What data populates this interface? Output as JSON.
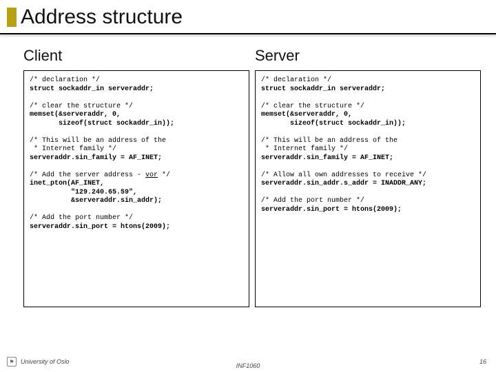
{
  "header": {
    "title": "Address structure"
  },
  "columns": {
    "client": {
      "heading": "Client",
      "code": "/* declaration */\n<b>struct sockaddr_in serveraddr;</b>\n\n/* clear the structure */\n<b>memset(&serveraddr, 0,</b>\n<b>       sizeof(struct sockaddr_in));</b>\n\n/* This will be an address of the\n * Internet family */\n<b>serveraddr.sin_family = AF_INET;</b>\n\n/* Add the server address - <span class=\"ul\">vor</span> */\n<b>inet_pton(AF_INET,</b>\n<b>          \"129.240.65.59\",</b>\n<b>          &serveraddr.sin_addr);</b>\n\n/* Add the port number */\n<b>serveraddr.sin_port = htons(2009);</b>"
    },
    "server": {
      "heading": "Server",
      "code": "/* declaration */\n<b>struct sockaddr_in serveraddr;</b>\n\n/* clear the structure */\n<b>memset(&serveraddr, 0,</b>\n<b>       sizeof(struct sockaddr_in));</b>\n\n/* This will be an address of the\n * Internet family */\n<b>serveraddr.sin_family = AF_INET;</b>\n\n/* Allow all own addresses to receive */\n<b>serveraddr.sin_addr.s_addr = INADDR_ANY;</b>\n\n/* Add the port number */\n<b>serveraddr.sin_port = htons(2009);</b>"
    }
  },
  "footer": {
    "institution": "University of Oslo",
    "course": "INF1060",
    "page": "16"
  }
}
